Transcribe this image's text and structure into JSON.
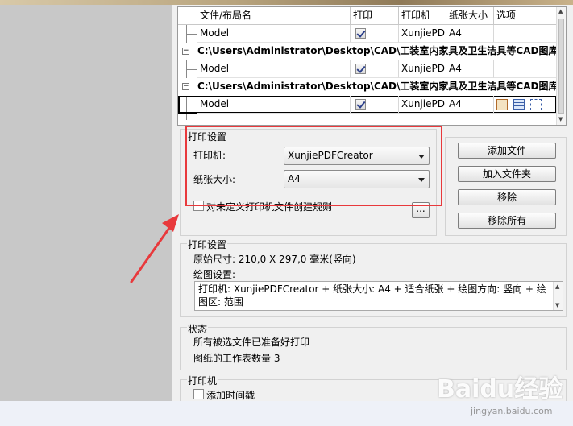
{
  "table": {
    "headers": [
      "文件/布局名",
      "打印",
      "打印机",
      "纸张大小",
      "选项"
    ],
    "rows": [
      {
        "kind": "file",
        "name": "Model",
        "print": true,
        "printer": "XunjiePDF",
        "paper": "A4"
      },
      {
        "kind": "group",
        "path": "C:\\Users\\Administrator\\Desktop\\CAD\\工装室内家具及卫生洁具等CAD图库\\工装"
      },
      {
        "kind": "file",
        "name": "Model",
        "print": true,
        "printer": "XunjiePDF",
        "paper": "A4"
      },
      {
        "kind": "group",
        "path": "C:\\Users\\Administrator\\Desktop\\CAD\\工装室内家具及卫生洁具等CAD图库\\工装"
      },
      {
        "kind": "file",
        "name": "Model",
        "print": true,
        "printer": "XunjiePDF",
        "paper": "A4",
        "selected": true,
        "option_icons": [
          "printer-settings-icon",
          "layers-icon",
          "page-setup-icon"
        ]
      }
    ]
  },
  "print_settings": {
    "title": "打印设置",
    "printer_label": "打印机:",
    "printer_value": "XunjiePDFCreator",
    "paper_label": "纸张大小:",
    "paper_value": "A4",
    "rule_checkbox_label": "对未定义打印机文件创建规则",
    "rule_checked": false,
    "browse_label": "..."
  },
  "buttons": {
    "add_file": "添加文件",
    "add_folder": "加入文件夹",
    "remove": "移除",
    "remove_all": "移除所有"
  },
  "plot_info": {
    "title": "打印设置",
    "original_size": "原始尺寸: 210,0 X 297,0 毫米(竖向)",
    "plot_settings_label": "绘图设置:",
    "plot_settings_text": "打印机: XunjiePDFCreator + 纸张大小: A4 + 适合纸张 + 绘图方向: 竖向 + 绘图区: 范围"
  },
  "status": {
    "title": "状态",
    "line1": "所有被选文件已准备好打印",
    "line2": "图纸的工作表数量 3"
  },
  "printer_section": {
    "title": "打印机",
    "timestamp_label": "添加时间戳",
    "timestamp_checked": false
  },
  "watermark": {
    "main": "Baidu经验",
    "sub": "jingyan.baidu.com"
  },
  "colors": {
    "highlight_box": "#e8393c",
    "selected_outline": "#000000"
  }
}
